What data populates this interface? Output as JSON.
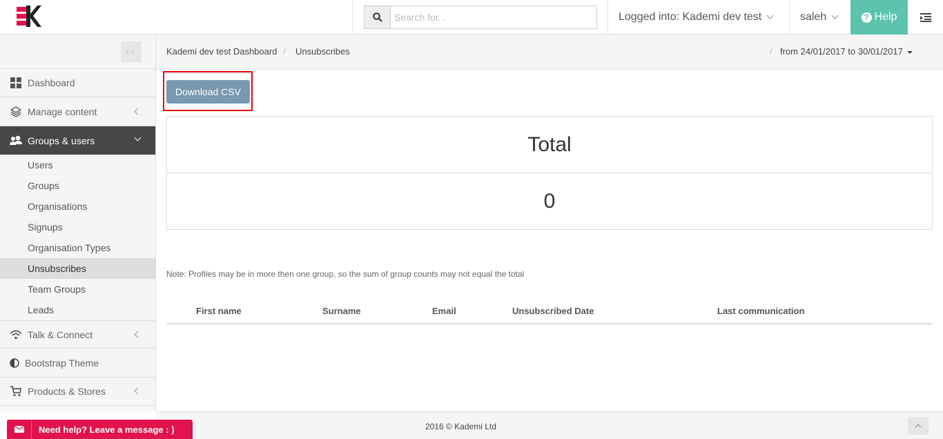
{
  "header": {
    "search_placeholder": "Search for...",
    "logged_into": "Logged into: Kademi dev test",
    "user": "saleh",
    "help": "Help"
  },
  "sidebar": {
    "items": [
      {
        "label": "Dashboard",
        "icon": "grid-icon"
      },
      {
        "label": "Manage content",
        "icon": "layers-icon"
      },
      {
        "label": "Groups & users",
        "icon": "users-icon",
        "active": true
      },
      {
        "label": "Talk & Connect",
        "icon": "wifi-icon"
      },
      {
        "label": "Bootstrap Theme",
        "icon": "contrast-icon"
      },
      {
        "label": "Products & Stores",
        "icon": "cart-icon"
      }
    ],
    "sub_items": [
      "Users",
      "Groups",
      "Organisations",
      "Signups",
      "Organisation Types",
      "Unsubscribes",
      "Team Groups",
      "Leads"
    ],
    "active_sub": "Unsubscribes"
  },
  "breadcrumb": {
    "home": "Kademi dev test Dashboard",
    "current": "Unsubscribes",
    "separator": "/",
    "daterange": "from 24/01/2017 to 30/01/2017"
  },
  "main": {
    "download_button": "Download CSV",
    "total_label": "Total",
    "total_value": "0",
    "note": "Note: Profiles may be in more then one group, so the sum of group counts may not equal the total",
    "columns": [
      "First name",
      "Surname",
      "Email",
      "Unsubscribed Date",
      "Last communication"
    ]
  },
  "footer": {
    "copyright": "2016 © Kademi Ltd",
    "help_message": "Need help? Leave a message : )"
  },
  "colors": {
    "accent": "#5cc4ad",
    "active_nav": "#474747",
    "csv_button": "#7899b0",
    "highlight_frame": "#ee0000",
    "help_message": "#e2124d",
    "logo_red": "#e2124d"
  }
}
